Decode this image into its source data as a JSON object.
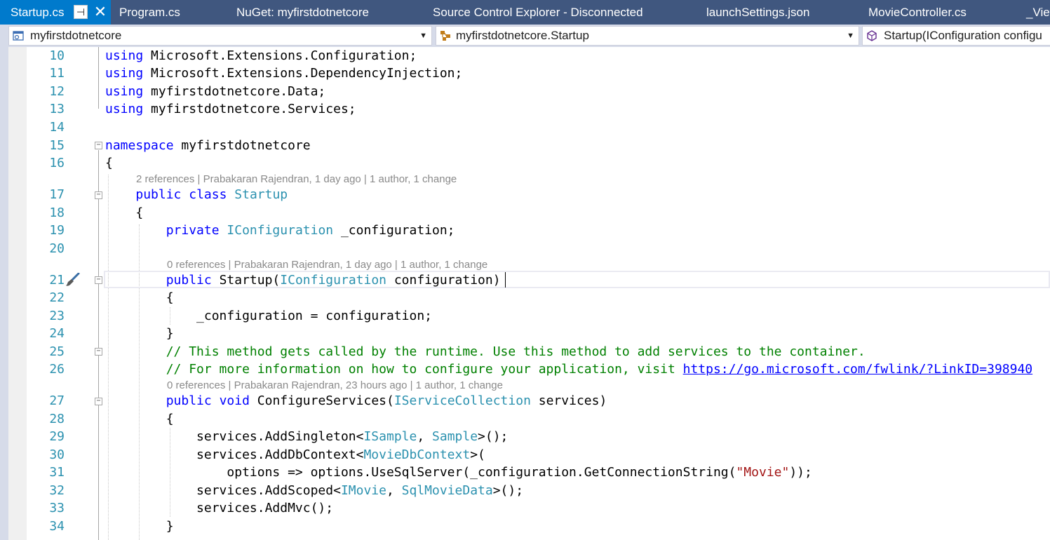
{
  "tabs": [
    {
      "label": "Startup.cs",
      "active": true
    },
    {
      "label": "Program.cs",
      "active": false
    },
    {
      "label": "NuGet: myfirstdotnetcore",
      "active": false
    },
    {
      "label": "Source Control Explorer - Disconnected",
      "active": false
    },
    {
      "label": "launchSettings.json",
      "active": false
    },
    {
      "label": "MovieController.cs",
      "active": false
    },
    {
      "label": "_View",
      "active": false
    }
  ],
  "navbar": {
    "project": "myfirstdotnetcore",
    "type": "myfirstdotnetcore.Startup",
    "member": "Startup(IConfiguration configu"
  },
  "codelens": {
    "class": "2 references | Prabakaran Rajendran, 1 day ago | 1 author, 1 change",
    "ctor": "0 references | Prabakaran Rajendran, 1 day ago | 1 author, 1 change",
    "configure": "0 references | Prabakaran Rajendran, 23 hours ago | 1 author, 1 change"
  },
  "lines": [
    {
      "num": "10",
      "tokens": [
        {
          "t": "using",
          "c": "kw"
        },
        {
          "t": " Microsoft.Extensions.Configuration;",
          "c": ""
        }
      ]
    },
    {
      "num": "11",
      "tokens": [
        {
          "t": "using",
          "c": "kw"
        },
        {
          "t": " Microsoft.Extensions.DependencyInjection;",
          "c": ""
        }
      ]
    },
    {
      "num": "12",
      "tokens": [
        {
          "t": "using",
          "c": "kw"
        },
        {
          "t": " myfirstdotnetcore.Data;",
          "c": ""
        }
      ]
    },
    {
      "num": "13",
      "tokens": [
        {
          "t": "using",
          "c": "kw"
        },
        {
          "t": " myfirstdotnetcore.Services;",
          "c": ""
        }
      ]
    },
    {
      "num": "14",
      "tokens": []
    },
    {
      "num": "15",
      "tokens": [
        {
          "t": "namespace",
          "c": "kw"
        },
        {
          "t": " myfirstdotnetcore",
          "c": ""
        }
      ]
    },
    {
      "num": "16",
      "tokens": [
        {
          "t": "{",
          "c": ""
        }
      ]
    },
    {
      "num": "17",
      "tokens": [
        {
          "t": "    ",
          "c": ""
        },
        {
          "t": "public",
          "c": "kw"
        },
        {
          "t": " ",
          "c": ""
        },
        {
          "t": "class",
          "c": "kw"
        },
        {
          "t": " ",
          "c": ""
        },
        {
          "t": "Startup",
          "c": "ty"
        }
      ]
    },
    {
      "num": "18",
      "tokens": [
        {
          "t": "    {",
          "c": ""
        }
      ]
    },
    {
      "num": "19",
      "tokens": [
        {
          "t": "        ",
          "c": ""
        },
        {
          "t": "private",
          "c": "kw"
        },
        {
          "t": " ",
          "c": ""
        },
        {
          "t": "IConfiguration",
          "c": "ty"
        },
        {
          "t": " _configuration;",
          "c": ""
        }
      ]
    },
    {
      "num": "20",
      "tokens": []
    },
    {
      "num": "21",
      "tokens": [
        {
          "t": "        ",
          "c": ""
        },
        {
          "t": "public",
          "c": "kw"
        },
        {
          "t": " Startup(",
          "c": ""
        },
        {
          "t": "IConfiguration",
          "c": "ty"
        },
        {
          "t": " configuration)",
          "c": ""
        }
      ]
    },
    {
      "num": "22",
      "tokens": [
        {
          "t": "        {",
          "c": ""
        }
      ]
    },
    {
      "num": "23",
      "tokens": [
        {
          "t": "            _configuration = configuration;",
          "c": ""
        }
      ]
    },
    {
      "num": "24",
      "tokens": [
        {
          "t": "        }",
          "c": ""
        }
      ]
    },
    {
      "num": "25",
      "tokens": [
        {
          "t": "        ",
          "c": ""
        },
        {
          "t": "// This method gets called by the runtime. Use this method to add services to the container.",
          "c": "cm"
        }
      ]
    },
    {
      "num": "26",
      "tokens": [
        {
          "t": "        ",
          "c": ""
        },
        {
          "t": "// For more information on how to configure your application, visit ",
          "c": "cm"
        },
        {
          "t": "https://go.microsoft.com/fwlink/?LinkID=398940",
          "c": "lk"
        }
      ]
    },
    {
      "num": "27",
      "tokens": [
        {
          "t": "        ",
          "c": ""
        },
        {
          "t": "public",
          "c": "kw"
        },
        {
          "t": " ",
          "c": ""
        },
        {
          "t": "void",
          "c": "kw"
        },
        {
          "t": " ConfigureServices(",
          "c": ""
        },
        {
          "t": "IServiceCollection",
          "c": "ty"
        },
        {
          "t": " services)",
          "c": ""
        }
      ]
    },
    {
      "num": "28",
      "tokens": [
        {
          "t": "        {",
          "c": ""
        }
      ]
    },
    {
      "num": "29",
      "tokens": [
        {
          "t": "            services.AddSingleton<",
          "c": ""
        },
        {
          "t": "ISample",
          "c": "ty"
        },
        {
          "t": ", ",
          "c": ""
        },
        {
          "t": "Sample",
          "c": "ty"
        },
        {
          "t": ">();",
          "c": ""
        }
      ]
    },
    {
      "num": "30",
      "tokens": [
        {
          "t": "            services.AddDbContext<",
          "c": ""
        },
        {
          "t": "MovieDbContext",
          "c": "ty"
        },
        {
          "t": ">(",
          "c": ""
        }
      ]
    },
    {
      "num": "31",
      "tokens": [
        {
          "t": "                options => options.UseSqlServer(_configuration.GetConnectionString(",
          "c": ""
        },
        {
          "t": "\"Movie\"",
          "c": "st"
        },
        {
          "t": "));",
          "c": ""
        }
      ]
    },
    {
      "num": "32",
      "tokens": [
        {
          "t": "            services.AddScoped<",
          "c": ""
        },
        {
          "t": "IMovie",
          "c": "ty"
        },
        {
          "t": ", ",
          "c": ""
        },
        {
          "t": "SqlMovieData",
          "c": "ty"
        },
        {
          "t": ">();",
          "c": ""
        }
      ]
    },
    {
      "num": "33",
      "tokens": [
        {
          "t": "            services.AddMvc();",
          "c": ""
        }
      ]
    },
    {
      "num": "34",
      "tokens": [
        {
          "t": "        }",
          "c": ""
        }
      ]
    }
  ]
}
